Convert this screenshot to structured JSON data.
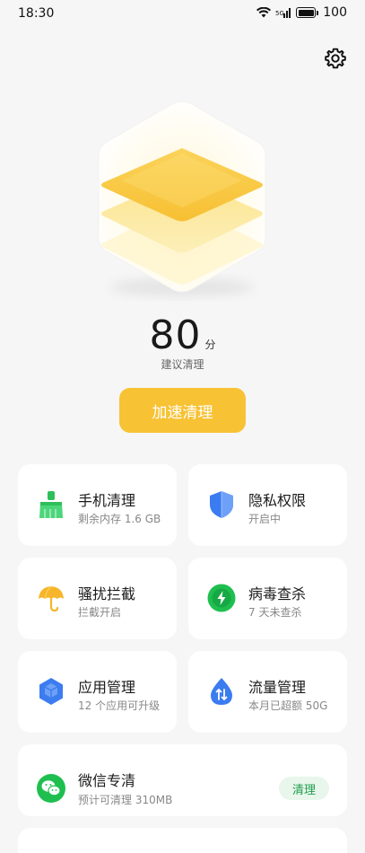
{
  "status_bar": {
    "time": "18:30",
    "battery": "100"
  },
  "score": {
    "value": "80",
    "unit": "分",
    "subtitle": "建议清理"
  },
  "boost_button": "加速清理",
  "cards": [
    {
      "title": "手机清理",
      "subtitle": "剩余内存 1.6 GB",
      "icon": "broom-icon"
    },
    {
      "title": "隐私权限",
      "subtitle": "开启中",
      "icon": "shield-icon"
    },
    {
      "title": "骚扰拦截",
      "subtitle": "拦截开启",
      "icon": "umbrella-icon"
    },
    {
      "title": "病毒查杀",
      "subtitle": "7 天未查杀",
      "icon": "lightning-shield-icon"
    },
    {
      "title": "应用管理",
      "subtitle": "12 个应用可升级",
      "icon": "cube-icon"
    },
    {
      "title": "流量管理",
      "subtitle": "本月已超额 50G",
      "icon": "data-drop-icon"
    }
  ],
  "wechat": {
    "title": "微信专清",
    "subtitle": "预计可清理 310MB",
    "action": "清理",
    "icon": "wechat-icon"
  },
  "colors": {
    "accent": "#f8c235",
    "green": "#1fbf4f",
    "blue": "#3b7cf0"
  }
}
